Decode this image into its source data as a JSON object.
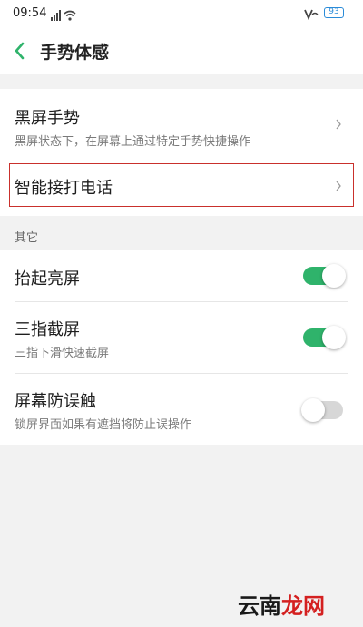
{
  "status_bar": {
    "time": "09:54",
    "battery": "93",
    "signal_icon": "signal-icon",
    "wifi_icon": "wifi-icon",
    "vowifi_icon": "vowifi-icon"
  },
  "header": {
    "title": "手势体感",
    "back_icon": "chevron-left-icon"
  },
  "items": [
    {
      "title": "黑屏手势",
      "subtitle": "黑屏状态下，在屏幕上通过特定手势快捷操作",
      "control": "chevron"
    },
    {
      "title": "智能接打电话",
      "subtitle": "",
      "control": "chevron",
      "highlighted": true
    }
  ],
  "section_other": {
    "label": "其它",
    "items": [
      {
        "title": "抬起亮屏",
        "subtitle": "",
        "toggle": true
      },
      {
        "title": "三指截屏",
        "subtitle": "三指下滑快速截屏",
        "toggle": true
      },
      {
        "title": "屏幕防误触",
        "subtitle": "锁屏界面如果有遮挡将防止误操作",
        "toggle": false
      }
    ]
  },
  "watermark": {
    "part1": "云南",
    "part2": "龙网"
  },
  "colors": {
    "accent_green": "#2fb36b",
    "back_arrow_green": "#2fb36b",
    "highlight_red": "#c9302c",
    "background": "#f2f2f2"
  }
}
